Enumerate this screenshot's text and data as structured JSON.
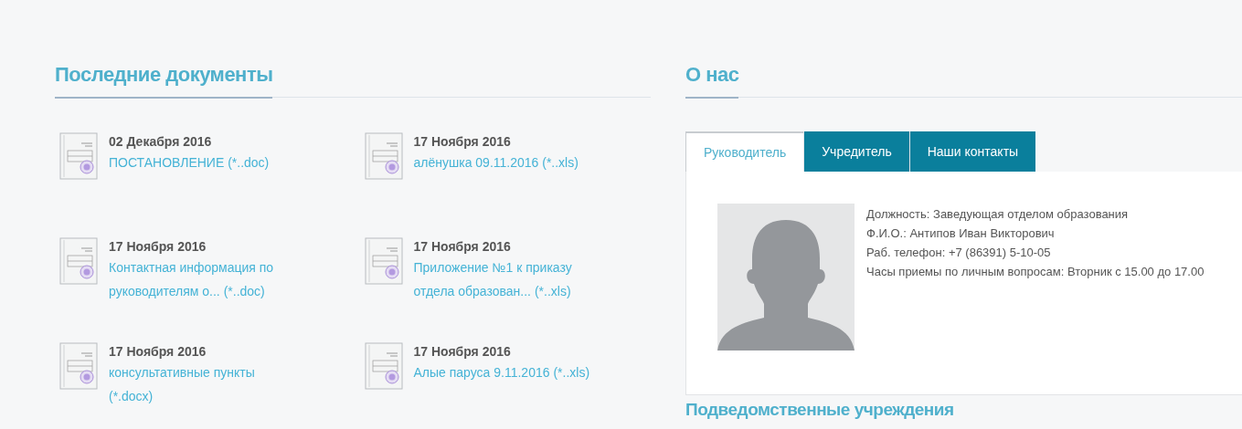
{
  "documents": {
    "title": "Последние документы",
    "items": [
      {
        "date": "02 Декабря 2016",
        "link": "ПОСТАНОВЛЕНИЕ (*..doc)"
      },
      {
        "date": "17 Ноября 2016",
        "link": "алёнушка 09.11.2016 (*..xls)"
      },
      {
        "date": "17 Ноября 2016",
        "link": "Контактная информация по руководителям о... (*..doc)"
      },
      {
        "date": "17 Ноября 2016",
        "link": "Приложение №1 к приказу отдела образован... (*..xls)"
      },
      {
        "date": "17 Ноября 2016",
        "link": "консультативные пункты (*.docx)"
      },
      {
        "date": "17 Ноября 2016",
        "link": "Алые паруса 9.11.2016 (*..xls)"
      }
    ]
  },
  "about": {
    "title": "О нас",
    "tabs": [
      {
        "label": "Руководитель",
        "selected": true
      },
      {
        "label": "Учредитель",
        "selected": false
      },
      {
        "label": "Наши контакты",
        "selected": false
      }
    ],
    "info": [
      "Должность: Заведующая отделом образования",
      "Ф.И.О.: Антипов Иван Викторович",
      "Раб. телефон: +7 (86391) 5-10-05",
      "Часы приемы по личным вопросам: Вторник с 15.00 до 17.00"
    ]
  },
  "subordinate": {
    "title": "Подведомственные учреждения"
  }
}
